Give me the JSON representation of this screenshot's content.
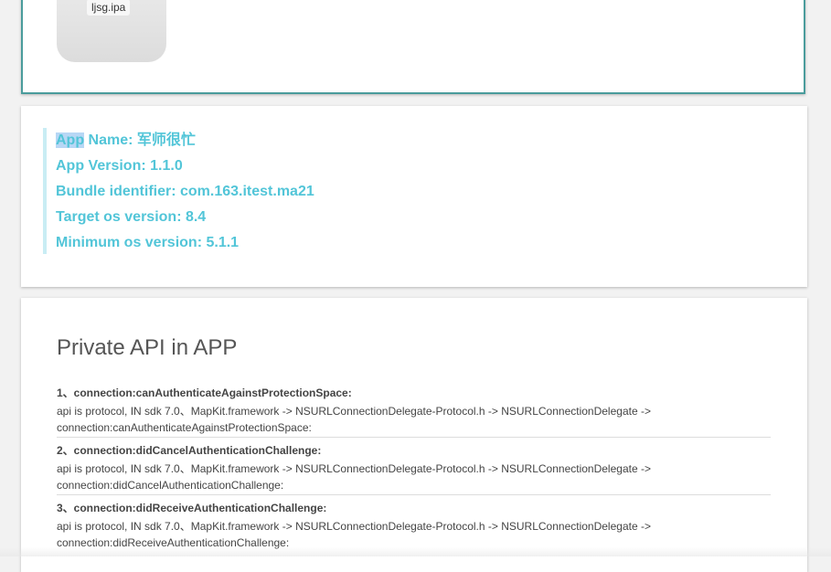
{
  "upload": {
    "file_name": "ljsg.ipa"
  },
  "app_info": {
    "selected_text": "App",
    "name_rest": " Name: 军师很忙",
    "version": "App Version: 1.1.0",
    "bundle": "Bundle identifier: com.163.itest.ma21",
    "target_os": "Target os version: 8.4",
    "min_os": "Minimum os version: 5.1.1"
  },
  "private_api": {
    "title": "Private API in APP",
    "items": [
      {
        "heading": "1、connection:canAuthenticateAgainstProtectionSpace:",
        "desc": "api is protocol, IN sdk 7.0、MapKit.framework -> NSURLConnectionDelegate-Protocol.h -> NSURLConnectionDelegate -> connection:canAuthenticateAgainstProtectionSpace:"
      },
      {
        "heading": "2、connection:didCancelAuthenticationChallenge:",
        "desc": "api is protocol, IN sdk 7.0、MapKit.framework -> NSURLConnectionDelegate-Protocol.h -> NSURLConnectionDelegate -> connection:didCancelAuthenticationChallenge:"
      },
      {
        "heading": "3、connection:didReceiveAuthenticationChallenge:",
        "desc": "api is protocol, IN sdk 7.0、MapKit.framework -> NSURLConnectionDelegate-Protocol.h -> NSURLConnectionDelegate -> connection:didReceiveAuthenticationChallenge:"
      }
    ]
  },
  "colors": {
    "accent": "#52c5d8",
    "card_border": "#4a9c9c",
    "selection": "#b7d7f5"
  }
}
